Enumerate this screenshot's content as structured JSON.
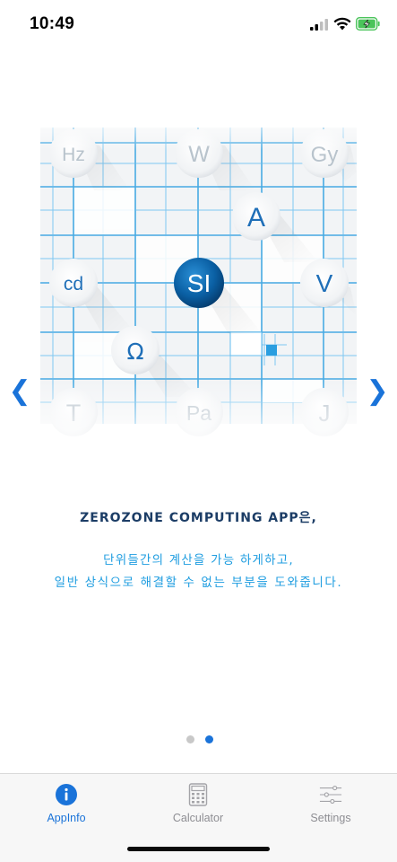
{
  "status_bar": {
    "time": "10:49"
  },
  "hero": {
    "units": {
      "hz": "Hz",
      "w": "W",
      "gy": "Gy",
      "a": "A",
      "cd": "cd",
      "si": "SI",
      "v": "V",
      "ohm": "Ω",
      "t": "T",
      "pa": "Pa",
      "j": "J"
    }
  },
  "nav": {
    "prev_icon": "chevron-left-icon",
    "next_icon": "chevron-right-icon",
    "prev_glyph": "❮",
    "next_glyph": "❯"
  },
  "content": {
    "title": "ZEROZONE COMPUTING APP은,",
    "line1": "단위들간의 계산을 가능 하게하고,",
    "line2": "일반 상식으로 해결할 수 없는 부분을 도와줍니다."
  },
  "pager": {
    "total": 2,
    "current": 2
  },
  "tab_bar": {
    "tabs": [
      {
        "label": "AppInfo",
        "icon": "info-icon",
        "active": true
      },
      {
        "label": "Calculator",
        "icon": "calculator-icon",
        "active": false
      },
      {
        "label": "Settings",
        "icon": "settings-sliders-icon",
        "active": false
      }
    ]
  },
  "colors": {
    "accent": "#1a73d9",
    "title": "#1c3d66",
    "description": "#1f9de0",
    "grid": "#2a9ee0"
  }
}
